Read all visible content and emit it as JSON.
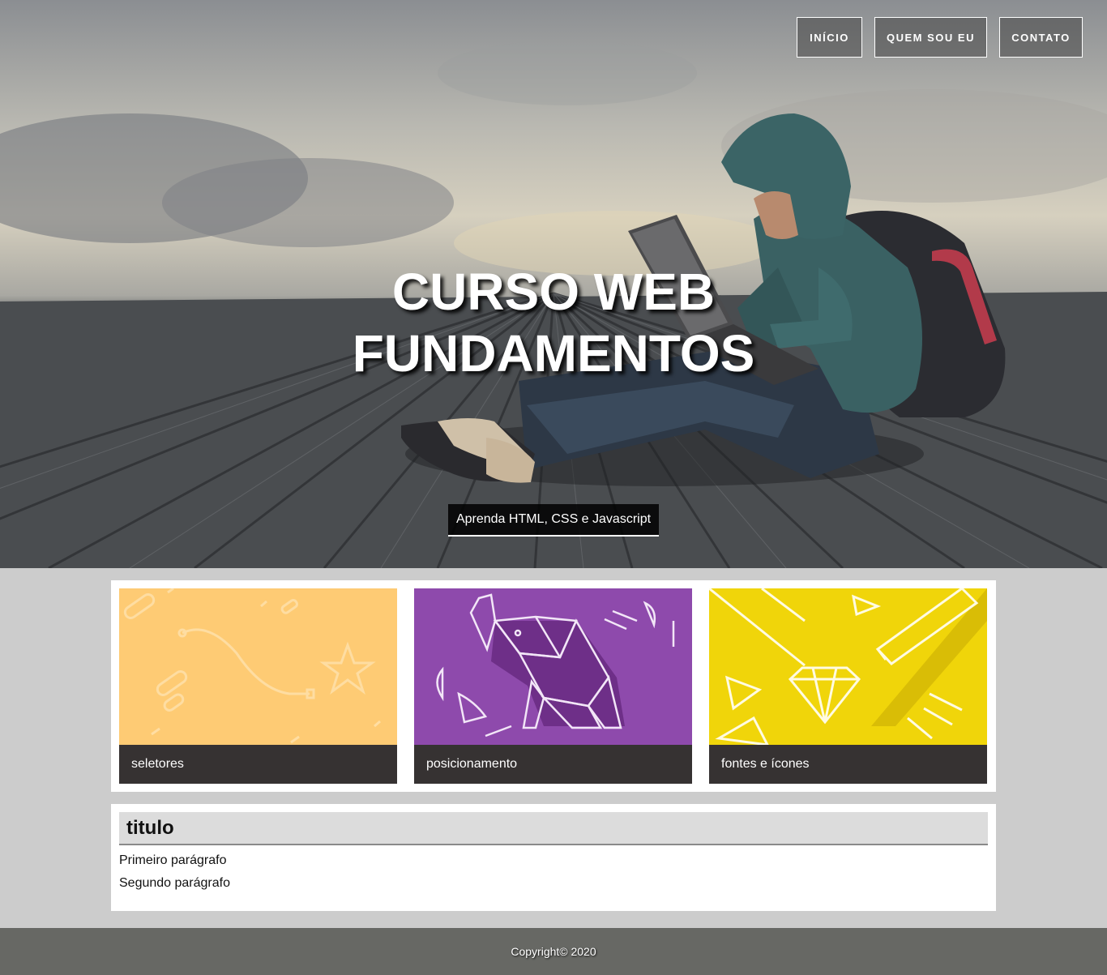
{
  "nav": {
    "items": [
      {
        "label": "INÍCIO"
      },
      {
        "label": "QUEM SOU EU"
      },
      {
        "label": "CONTATO"
      }
    ]
  },
  "hero": {
    "title_line1": "CURSO WEB",
    "title_line2": "FUNDAMENTOS",
    "subtitle": "Aprenda HTML, CSS e Javascript"
  },
  "cards": [
    {
      "label": "seletores",
      "color": "#fecb74"
    },
    {
      "label": "posicionamento",
      "color": "#8e4aac"
    },
    {
      "label": "fontes e ícones",
      "color": "#f0d50a"
    }
  ],
  "content": {
    "title": "titulo",
    "paragraphs": [
      "Primeiro parágrafo",
      "Segundo parágrafo"
    ]
  },
  "footer": {
    "text": "Copyright© 2020"
  }
}
